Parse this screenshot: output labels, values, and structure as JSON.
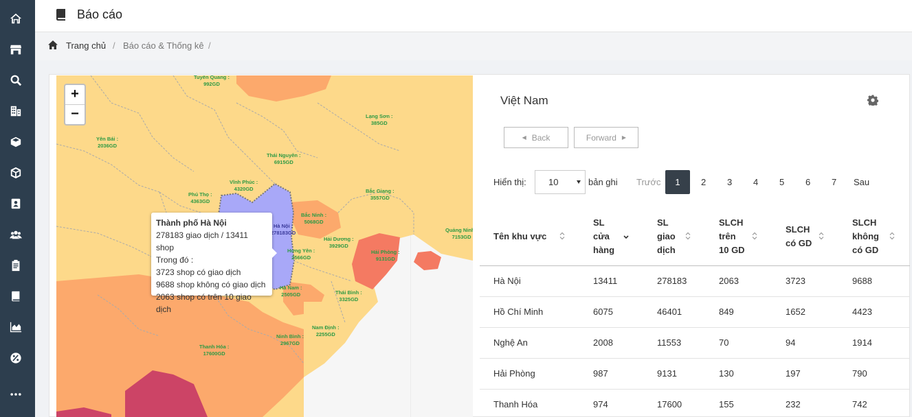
{
  "header": {
    "title": "Báo cáo"
  },
  "breadcrumb": {
    "home": "Trang chủ",
    "section": "Báo cáo & Thống kê",
    "sep": "/"
  },
  "map": {
    "zoom_in": "+",
    "zoom_out": "−",
    "labels": [
      {
        "name": "Tuyên Quang :",
        "value": "992GD"
      },
      {
        "name": "Yên Bái :",
        "value": "2036GD"
      },
      {
        "name": "Lạng Sơn :",
        "value": "385GD"
      },
      {
        "name": "Thái Nguyên :",
        "value": "6915GD"
      },
      {
        "name": "Vĩnh Phúc :",
        "value": "4320GD"
      },
      {
        "name": "Bắc Giang :",
        "value": "3557GD"
      },
      {
        "name": "Phú Thọ :",
        "value": "4363GD"
      },
      {
        "name": "Bắc Ninh :",
        "value": "5068GD"
      },
      {
        "name": "Quảng Ninh :",
        "value": "7153GD"
      },
      {
        "name": "Hải Dương :",
        "value": "3929GD"
      },
      {
        "name": "Hải Phòng :",
        "value": "9131GD"
      },
      {
        "name": "Hưng Yên :",
        "value": "2566GD"
      },
      {
        "name": "Hà Nam :",
        "value": "2505GD"
      },
      {
        "name": "Thái Bình :",
        "value": "3325GD"
      },
      {
        "name": "Nam Định :",
        "value": "2255GD"
      },
      {
        "name": "Ninh Bình :",
        "value": "2967GD"
      },
      {
        "name": "Thanh Hóa :",
        "value": "17600GD"
      },
      {
        "name": "Hà Nội :",
        "value": "278183GD"
      }
    ],
    "tooltip": {
      "title": "Thành phố Hà Nội",
      "line1": "278183 giao dịch / 13411 shop",
      "line2": "Trong đó :",
      "line3": "3723 shop có giao dịch",
      "line4": "9688 shop không có giao dịch",
      "line5": "2063 shop có trên 10 giao dịch"
    }
  },
  "panel": {
    "title": "Việt Nam",
    "back_label": "Back",
    "forward_label": "Forward",
    "show_label": "Hiển thị:",
    "page_size": "10",
    "records_label": "bản ghi",
    "prev_label": "Trước",
    "next_label": "Sau",
    "pages": [
      "1",
      "2",
      "3",
      "4",
      "5",
      "6",
      "7"
    ],
    "active_page": "1"
  },
  "table": {
    "headers": [
      "Tên khu vực",
      "SL\ncửa\nhàng",
      "SL\ngiao\ndịch",
      "SLCH\ntrên\n10 GD",
      "SLCH\ncó GD",
      "SLCH\nkhông\ncó GD"
    ],
    "rows": [
      [
        "Hà Nội",
        "13411",
        "278183",
        "2063",
        "3723",
        "9688"
      ],
      [
        "Hồ Chí Minh",
        "6075",
        "46401",
        "849",
        "1652",
        "4423"
      ],
      [
        "Nghệ An",
        "2008",
        "11553",
        "70",
        "94",
        "1914"
      ],
      [
        "Hải Phòng",
        "987",
        "9131",
        "130",
        "197",
        "790"
      ],
      [
        "Thanh Hóa",
        "974",
        "17600",
        "155",
        "232",
        "742"
      ]
    ]
  },
  "colors": {
    "sidebar": "#2d3e4e",
    "active_page": "#36404a",
    "map_low": "#fdd98a",
    "map_mid": "#fca96c",
    "map_high": "#f47a62",
    "map_hanoi": "#a8a8f8",
    "map_deep": "#cc4466",
    "map_label": "#2e9a44"
  }
}
